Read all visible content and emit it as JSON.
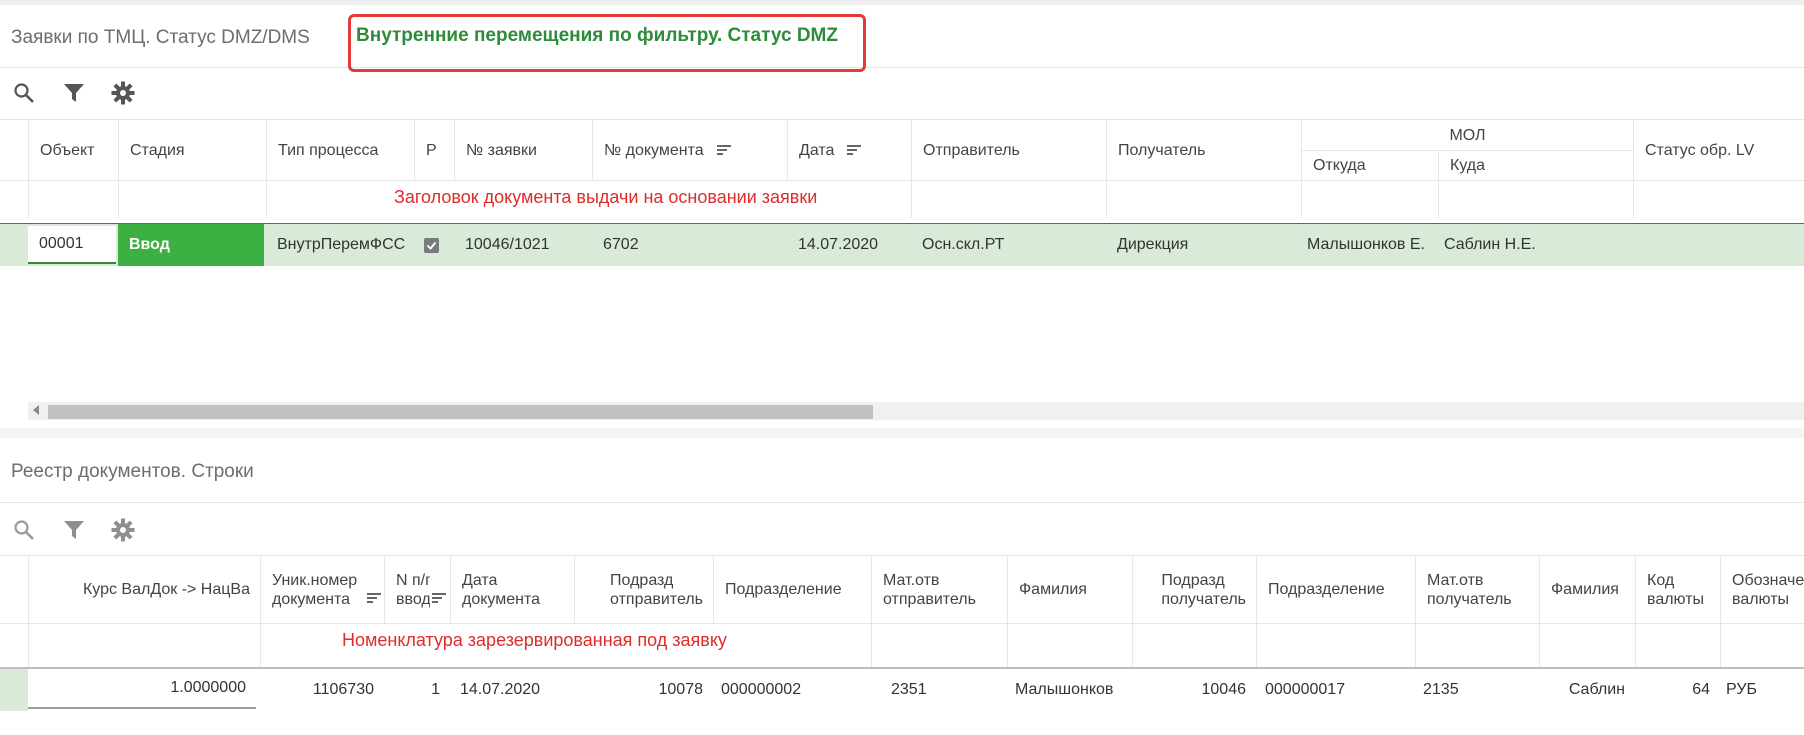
{
  "panel1": {
    "title": "Заявки по ТМЦ. Статус DMZ/DMS",
    "subtitle": "Внутренние перемещения по фильтру. Статус DMZ",
    "headers": {
      "object": "Объект",
      "stage": "Стадия",
      "process_type": "Тип процесса",
      "r": "Р",
      "request_no": "№ заявки",
      "doc_no": "№ документа",
      "date": "Дата",
      "sender": "Отправитель",
      "receiver": "Получатель",
      "mol": "МОЛ",
      "from": "Откуда",
      "to": "Куда",
      "status_lv": "Статус обр. LV"
    },
    "annotation": "Заголовок документа выдачи на основании заявки",
    "row": {
      "object": "00001",
      "stage": "Ввод",
      "process_type": "ВнутрПеремФСС",
      "r_checked": true,
      "request_no": "10046/1021",
      "doc_no": "6702",
      "date": "14.07.2020",
      "sender": "Осн.скл.РТ",
      "receiver": "Дирекция",
      "from": "Малышонков Е.",
      "to": "Саблин Н.Е.",
      "status_lv": ""
    }
  },
  "panel2": {
    "title": "Реестр документов. Строки",
    "headers": {
      "rate": "Курс ВалДок -> НацВа",
      "uniq_l1": "Уник.номер",
      "uniq_l2": "документа",
      "npp_l1": "N п/г",
      "npp_l2": "ввод",
      "docdate_l1": "Дата",
      "docdate_l2": "документа",
      "subsend_l1": "Подразд",
      "subsend_l2": "отправитель",
      "division1": "Подразделение",
      "molsend_l1": "Мат.отв",
      "molsend_l2": "отправитель",
      "surname1": "Фамилия",
      "subrecv_l1": "Подразд",
      "subrecv_l2": "получатель",
      "division2": "Подразделение",
      "molrecv_l1": "Мат.отв",
      "molrecv_l2": "получатель",
      "surname2": "Фамилия",
      "code_l1": "Код",
      "code_l2": "валюты",
      "desig_l1": "Обозначен",
      "desig_l2": "валюты"
    },
    "annotation": "Номенклатура зарезервированная под заявку",
    "row": {
      "rate": "1.0000000",
      "uniq": "1106730",
      "npp": "1",
      "docdate": "14.07.2020",
      "subsend": "10078",
      "division1": "000000002",
      "molsend": "2351",
      "surname1": "Малышонков",
      "subrecv": "10046",
      "division2": "000000017",
      "molrecv": "2135",
      "surname2": "Саблин",
      "code": "64",
      "desig": "РУБ"
    }
  },
  "colors": {
    "accent_green": "#2e8b3a",
    "stage_green": "#3cb043",
    "row_highlight": "#d9ead9",
    "annotation_red": "#e02b2b"
  },
  "icons": [
    "search-icon",
    "filter-icon",
    "gear-icon"
  ]
}
